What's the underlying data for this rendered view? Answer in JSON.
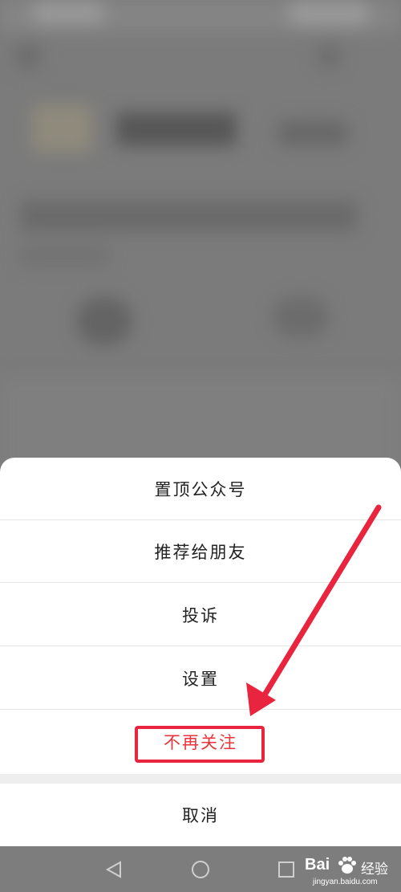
{
  "action_sheet": {
    "items": [
      {
        "label": "置顶公众号"
      },
      {
        "label": "推荐给朋友"
      },
      {
        "label": "投诉"
      },
      {
        "label": "设置"
      },
      {
        "label": "不再关注"
      }
    ],
    "cancel_label": "取消"
  },
  "watermark": {
    "brand": "Bai",
    "brand_suffix": "经验",
    "url": "jingyan.baidu.com"
  },
  "colors": {
    "accent_red": "#e8343a",
    "annotation_red": "#e8243e",
    "dim_overlay": "#7b7b7b"
  },
  "icons": {
    "nav": [
      "back-triangle-icon",
      "home-circle-icon",
      "recents-square-icon"
    ],
    "annotation": "red-arrow-icon",
    "logo": "baidu-paw-icon"
  }
}
